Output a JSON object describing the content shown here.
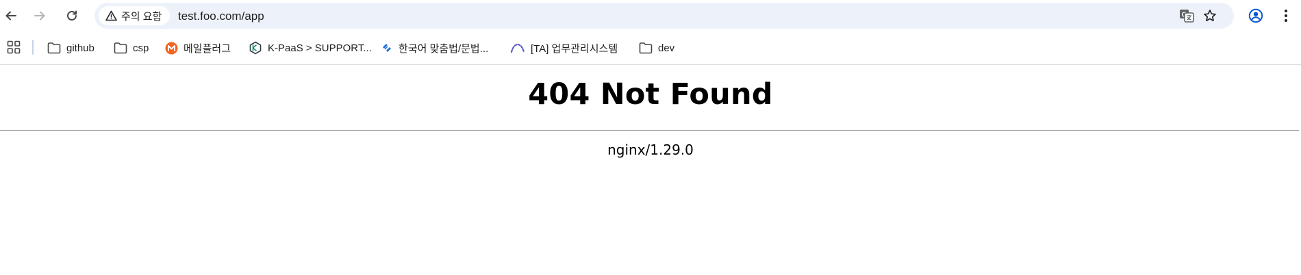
{
  "browser": {
    "security_chip": {
      "label": "주의 요함",
      "icon": "warning-icon"
    },
    "url": "test.foo.com/app",
    "nav": {
      "back_icon": "arrow-left-icon",
      "forward_icon": "arrow-right-icon",
      "reload_icon": "reload-icon"
    },
    "omnibox_icons": [
      "translate-icon",
      "star-icon"
    ],
    "profile_icon": "profile-icon",
    "menu_icon": "kebab-menu-icon"
  },
  "bookmarks": {
    "items": [
      {
        "label": "github",
        "icon": "folder-icon"
      },
      {
        "label": "csp",
        "icon": "folder-icon"
      },
      {
        "label": "메일플러그",
        "icon": "mailplug-favicon"
      },
      {
        "label": "K-PaaS > SUPPORT...",
        "icon": "kpaas-favicon"
      },
      {
        "label": "한국어 맞춤법/문법...",
        "icon": "spellcheck-favicon"
      },
      {
        "label": "[TA] 업무관리시스템",
        "icon": "ta-favicon"
      },
      {
        "label": "dev",
        "icon": "folder-icon"
      }
    ]
  },
  "page": {
    "title": "404 Not Found",
    "server": "nginx/1.29.0"
  },
  "colors": {
    "omnibox_bg": "#edf2fa",
    "mailplug_orange": "#f26522",
    "profile_blue": "#0b57d0"
  }
}
